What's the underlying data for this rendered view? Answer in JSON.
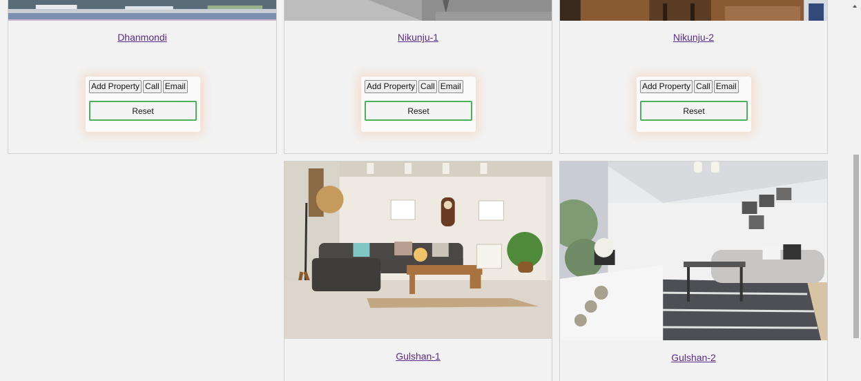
{
  "cards": [
    {
      "title": "Dhanmondi",
      "buttons": {
        "add": "Add Property",
        "call": "Call",
        "email": "Email",
        "reset": "Reset"
      }
    },
    {
      "title": "Nikunju-1",
      "buttons": {
        "add": "Add Property",
        "call": "Call",
        "email": "Email",
        "reset": "Reset"
      }
    },
    {
      "title": "Nikunju-2",
      "buttons": {
        "add": "Add Property",
        "call": "Call",
        "email": "Email",
        "reset": "Reset"
      }
    },
    {
      "title": "Gulshan-1"
    },
    {
      "title": "Gulshan-2"
    }
  ],
  "colors": {
    "link": "#5b2a8a",
    "reset_border": "#4cb05a",
    "page_bg": "#f2f2f2"
  },
  "icons": {
    "scroll_up": "triangle-up-icon"
  }
}
